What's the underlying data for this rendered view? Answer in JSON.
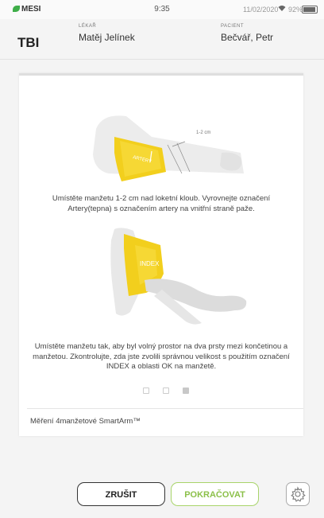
{
  "statusbar": {
    "brand": "MESI",
    "time": "9:35",
    "date": "11/02/2020",
    "battery": "92%"
  },
  "header": {
    "mode": "TBI",
    "doctor_label": "LÉKAŘ",
    "doctor_name": "Matěj Jelínek",
    "patient_label": "PACIENT",
    "patient_name": "Bečvář, Petr"
  },
  "steps": {
    "illustration1": {
      "cuff_text": "ARTERY",
      "measure_label": "1-2 cm"
    },
    "instruction1": "Umístěte manžetu 1-2 cm nad loketní kloub. Vyrovnejte označení Artery(tepna) s označením artery na vnitřní straně paže.",
    "illustration2": {
      "cuff_text": "INDEX"
    },
    "instruction2": "Umístěte manžetu tak, aby byl volný prostor na dva prsty mezi končetinou a manžetou. Zkontrolujte, zda jste zvolili správnou velikost s použitím označení INDEX a oblasti OK na manžetě.",
    "active_page": 3,
    "page_count": 3
  },
  "footer_text": "Měření 4manžetové SmartArm™",
  "buttons": {
    "cancel": "ZRUŠIT",
    "continue": "POKRAČOVAT"
  },
  "icons": {
    "settings": "gear-icon"
  },
  "colors": {
    "accent_green": "#8cc04a",
    "cuff_yellow": "#f2cf1d",
    "brand_green": "#3fae49"
  }
}
